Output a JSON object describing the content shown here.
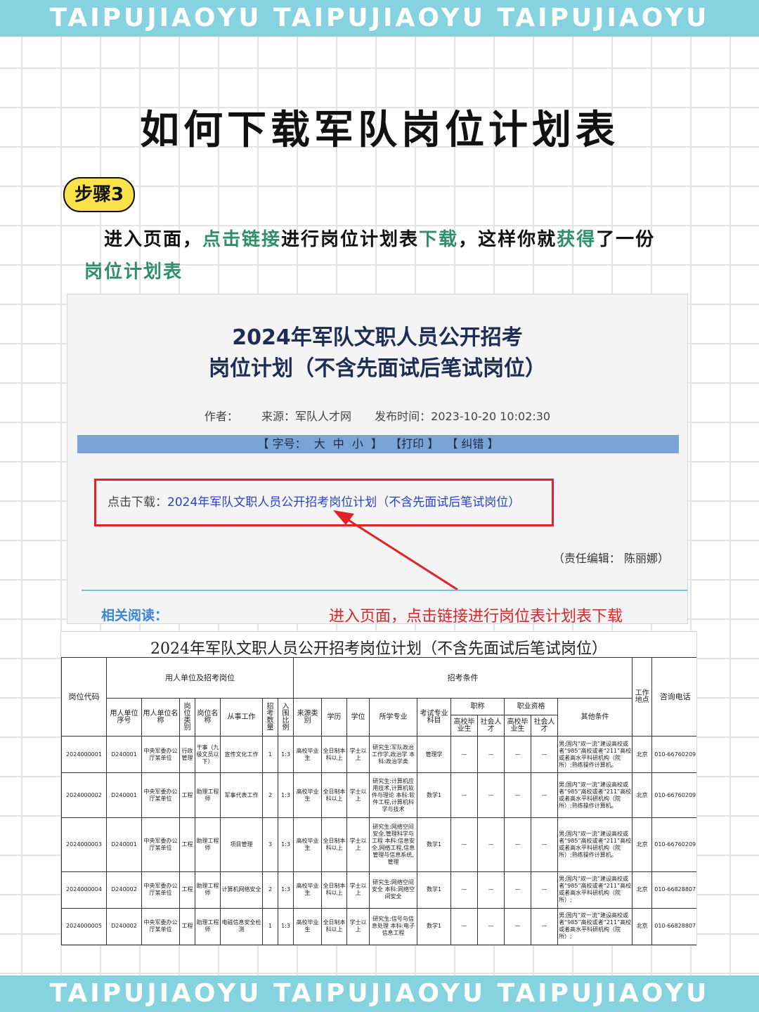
{
  "banner": {
    "text": "TAIPUJIAOYU TAIPUJIAOYU TAIPUJIAOYU"
  },
  "page_title": "如何下载军队岗位计划表",
  "step_badge": "步骤3",
  "instruction": {
    "part1": "进入页面，",
    "part2": "点击链接",
    "part3": "进行岗位计划表",
    "part4": "下载",
    "part5": "，这样你就",
    "part6": "获得",
    "part7": "了一份",
    "part8": "岗位计划表"
  },
  "colors": {
    "banner": "#86d3e0",
    "highlight": "#2f8f6a",
    "badge": "#f9e24a",
    "red": "#e0232a",
    "link": "#2a3fcf"
  },
  "article": {
    "title_line1": "2024年军队文职人员公开招考",
    "title_line2": "岗位计划（不含先面试后笔试岗位）",
    "author_label": "作者：",
    "source": "来源：军队人才网",
    "publish_time": "发布时间：2023-10-20 10:02:30",
    "toolbar": {
      "font_open": "【 字号：",
      "big": "大",
      "mid": "中",
      "small": "小",
      "font_close": "】",
      "print": "【打印 】",
      "correct": "【 纠错 】"
    },
    "download_label": "点击下载：",
    "download_link": "2024年军队文职人员公开招考岗位计划（不含先面试后笔试岗位）",
    "editor": "（责任编辑：  陈丽娜）",
    "related": "相关阅读：",
    "red_note": "进入页面，点击链接进行岗位表计划表下载"
  },
  "table": {
    "title": "2024年军队文职人员公开招考岗位计划（不含先面试后笔试岗位）",
    "group_headers": {
      "code": "岗位代码",
      "unit": "用人单位及招考岗位",
      "conditions": "招考条件",
      "location": "工作地点",
      "phone": "咨询电话"
    },
    "sub_headers": {
      "unit_no": "用人单位序号",
      "unit_name": "用人单位名称",
      "post_type": "岗位类别",
      "post_name": "岗位名称",
      "work": "从事工作",
      "count": "招考数量",
      "ratio": "入围比例",
      "source": "来源类别",
      "edu": "学历",
      "degree": "学位",
      "major": "所学专业",
      "exam": "考试专业科目",
      "title_group": "职称",
      "qual_group": "职业资格",
      "other": "其他条件",
      "title_grad": "高校毕业生",
      "title_social": "社会人才",
      "qual_grad": "高校毕业生",
      "qual_social": "社会人才"
    },
    "rows": [
      {
        "code": "2024000001",
        "unit_no": "D240001",
        "unit_name": "中央军委办公厅某单位",
        "post_type": "行政管理",
        "post_name": "干事（九级文员以下）",
        "work": "宣传文化工作",
        "count": "1",
        "ratio": "1:3",
        "source": "高校毕业生",
        "edu": "全日制本科以上",
        "degree": "学士以上",
        "major": "研究生:军队政治工作学,政治学 本科:政治学类",
        "exam": "管理学",
        "t1": "—",
        "t2": "—",
        "q1": "—",
        "q2": "—",
        "other": "男;国内“双一流”建设高校或者“985”高校或者“211”高校或者高水平科研机构（院所）;熟练操作计算机。",
        "location": "北京",
        "phone": "010-66760209"
      },
      {
        "code": "2024000002",
        "unit_no": "D240001",
        "unit_name": "中央军委办公厅某单位",
        "post_type": "工程",
        "post_name": "助理工程师",
        "work": "军事代表工作",
        "count": "2",
        "ratio": "1:3",
        "source": "高校毕业生",
        "edu": "全日制本科以上",
        "degree": "学士以上",
        "major": "研究生:计算机应用技术,计算机软件与理论 本科:软件工程,计算机科学与技术",
        "exam": "数学1",
        "t1": "—",
        "t2": "—",
        "q1": "—",
        "q2": "—",
        "other": "男;国内“双一流”建设高校或者“985”高校或者“211”高校或者高水平科研机构（院所）;熟练操作计算机。",
        "location": "北京",
        "phone": "010-66760209"
      },
      {
        "code": "2024000003",
        "unit_no": "D240001",
        "unit_name": "中央军委办公厅某单位",
        "post_type": "工程",
        "post_name": "助理工程师",
        "work": "项目管理",
        "count": "3",
        "ratio": "1:3",
        "source": "高校毕业生",
        "edu": "全日制本科以上",
        "degree": "学士以上",
        "major": "研究生:网络空间安全,管理科学与工程 本科:信息安全,网络工程,信息管理与信息系统,管理",
        "exam": "数学1",
        "t1": "—",
        "t2": "—",
        "q1": "—",
        "q2": "—",
        "other": "男;国内“双一流”建设高校或者“985”高校或者“211”高校或者高水平科研机构（院所）;熟练操作计算机。",
        "location": "北京",
        "phone": "010-66760209"
      },
      {
        "code": "2024000004",
        "unit_no": "D240002",
        "unit_name": "中央军委办公厅某单位",
        "post_type": "工程",
        "post_name": "助理工程师",
        "work": "计算机网络安全",
        "count": "2",
        "ratio": "1:3",
        "source": "高校毕业生",
        "edu": "全日制本科以上",
        "degree": "学士以上",
        "major": "研究生:网络空间安全 本科:网络空间安全",
        "exam": "数学1",
        "t1": "—",
        "t2": "—",
        "q1": "—",
        "q2": "—",
        "other": "男;国内“双一流”建设高校或者“985”高校或者“211”高校或者高水平科研机构（院所）;",
        "location": "北京",
        "phone": "010-66828807"
      },
      {
        "code": "2024000005",
        "unit_no": "D240002",
        "unit_name": "中央军委办公厅某单位",
        "post_type": "工程",
        "post_name": "助理工程师",
        "work": "电磁信息安全检测",
        "count": "1",
        "ratio": "1:3",
        "source": "高校毕业生",
        "edu": "全日制本科以上",
        "degree": "学士以上",
        "major": "研究生:信号与信息处理 本科:电子信息工程",
        "exam": "数学1",
        "t1": "—",
        "t2": "—",
        "q1": "—",
        "q2": "—",
        "other": "男;国内“双一流”建设高校或者“985”高校或者“211”高校或者高水平科研机构（院所）;",
        "location": "北京",
        "phone": "010-66828807"
      }
    ]
  }
}
